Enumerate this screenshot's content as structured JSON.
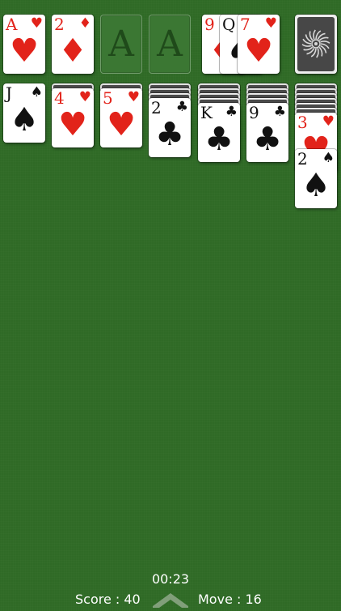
{
  "table": {
    "felt_color": "#2f6a26"
  },
  "suits": {
    "hearts": {
      "glyph": "♥",
      "color": "red"
    },
    "diamonds": {
      "glyph": "♦",
      "color": "red"
    },
    "clubs": {
      "glyph": "♣",
      "color": "black"
    },
    "spades": {
      "glyph": "♠",
      "color": "black"
    }
  },
  "foundations": [
    {
      "top": {
        "rank": "A",
        "suit": "hearts"
      }
    },
    {
      "top": {
        "rank": "2",
        "suit": "diamonds"
      }
    },
    {
      "top": null,
      "placeholder": "A"
    },
    {
      "top": null,
      "placeholder": "A"
    }
  ],
  "waste": [
    {
      "rank": "9",
      "suit": "diamonds"
    },
    {
      "rank": "Q",
      "suit": "spades"
    },
    {
      "rank": "7",
      "suit": "hearts"
    }
  ],
  "stock": {
    "has_cards": true,
    "back_icon": "spiral-sun-icon"
  },
  "tableau": [
    {
      "face_down": 0,
      "face_up": [
        {
          "rank": "J",
          "suit": "spades"
        }
      ]
    },
    {
      "face_down": 1,
      "face_up": [
        {
          "rank": "4",
          "suit": "hearts"
        }
      ]
    },
    {
      "face_down": 1,
      "face_up": [
        {
          "rank": "5",
          "suit": "hearts"
        }
      ]
    },
    {
      "face_down": 3,
      "face_up": [
        {
          "rank": "2",
          "suit": "clubs"
        }
      ]
    },
    {
      "face_down": 4,
      "face_up": [
        {
          "rank": "K",
          "suit": "clubs"
        }
      ]
    },
    {
      "face_down": 4,
      "face_up": [
        {
          "rank": "9",
          "suit": "clubs"
        }
      ]
    },
    {
      "face_down": 6,
      "face_up": [
        {
          "rank": "3",
          "suit": "hearts"
        },
        {
          "rank": "2",
          "suit": "spades"
        }
      ]
    }
  ],
  "hud": {
    "timer": "00:23",
    "score": "Score : 40",
    "moves": "Move : 16",
    "menu_icon": "chevron-up-icon"
  }
}
